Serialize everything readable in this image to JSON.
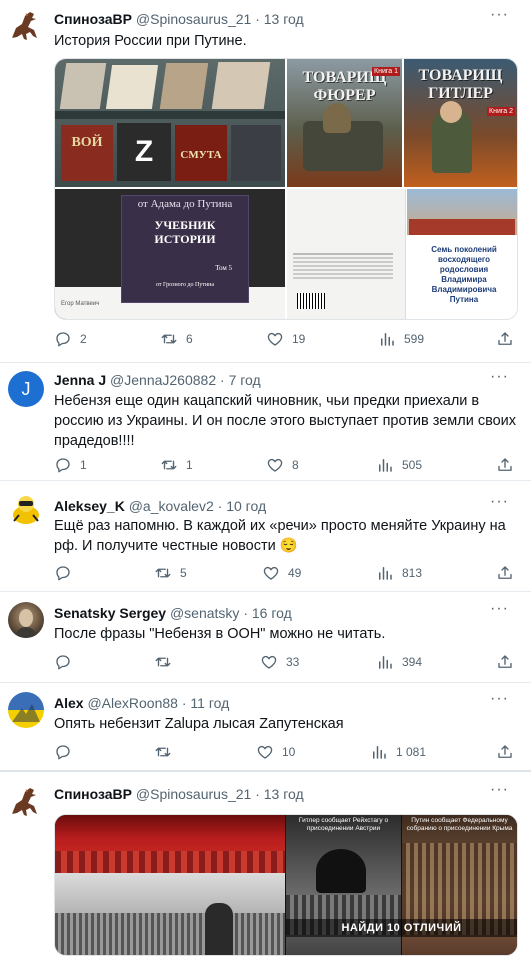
{
  "tweets": [
    {
      "name": "СпинозаВР",
      "handle": "@Spinosaurus_21",
      "time": "13 год",
      "text": "История России при Путине.",
      "replies": "2",
      "retweets": "6",
      "likes": "19",
      "views": "599"
    },
    {
      "name": "Jenna J",
      "handle": "@JennaJ260882",
      "time": "7 год",
      "avatar_letter": "J",
      "text": "Небензя еще один кацапский чиновник, чьи предки приехали в россию из Украины. И он после этого выступает против земли своих прадедов!!!!",
      "replies": "1",
      "retweets": "1",
      "likes": "8",
      "views": "505"
    },
    {
      "name": "Aleksey_K",
      "handle": "@a_kovalev2",
      "time": "10 год",
      "text": "Ещё раз напомню. В каждой их «речи» просто меняйте Украину на рф. И получите честные новости 😌",
      "replies": "",
      "retweets": "5",
      "likes": "49",
      "views": "813"
    },
    {
      "name": "Senatsky Sergey",
      "handle": "@senatsky",
      "time": "16 год",
      "text": "После фразы \"Небензя в ООН\" можно не читать.",
      "replies": "",
      "retweets": "",
      "likes": "33",
      "views": "394"
    },
    {
      "name": "Alex",
      "handle": "@AlexRoon88",
      "time": "11 год",
      "text": "Опять небензит Zalupa лысая Zапутенская",
      "replies": "",
      "retweets": "",
      "likes": "10",
      "views": "1 081"
    },
    {
      "name": "СпинозаВР",
      "handle": "@Spinosaurus_21",
      "time": "13 год"
    }
  ],
  "media1": {
    "book_a_title": "ТОВАРИЩ ФЮРЕР",
    "book_a_vol": "Книга 1",
    "book_b_title": "ТОВАРИЩ ГИТЛЕР",
    "book_b_vol": "Книга 2",
    "textbook_top": "от Адама до Путина",
    "textbook_title": "УЧЕБНИК ИСТОРИИ",
    "textbook_vol": "Том 5",
    "textbook_bottom": "от Грозного до Путина",
    "author_caption": "Егор Матвеич",
    "back_cover_text": "Семь поколений восходящего родословия Владимира Владимировича Путина",
    "shelf_b1": "ВОЙ",
    "shelf_b2": "Z",
    "shelf_b3": "СМУТА"
  },
  "media2": {
    "caption_left": "Гитлер сообщает Рейхстагу о присоединении Австрии",
    "caption_right": "Путин сообщает Федеральному собранию о присоединении Крыма",
    "find_diff": "НАЙДИ 10 ОТЛИЧИЙ"
  },
  "icons": {
    "more": "more-icon",
    "reply": "reply-icon",
    "retweet": "retweet-icon",
    "like": "heart-icon",
    "views": "views-icon",
    "share": "share-icon"
  },
  "colors": {
    "text": "#0f1419",
    "secondary": "#536471",
    "avatar_blue": "#1d6fd1"
  }
}
